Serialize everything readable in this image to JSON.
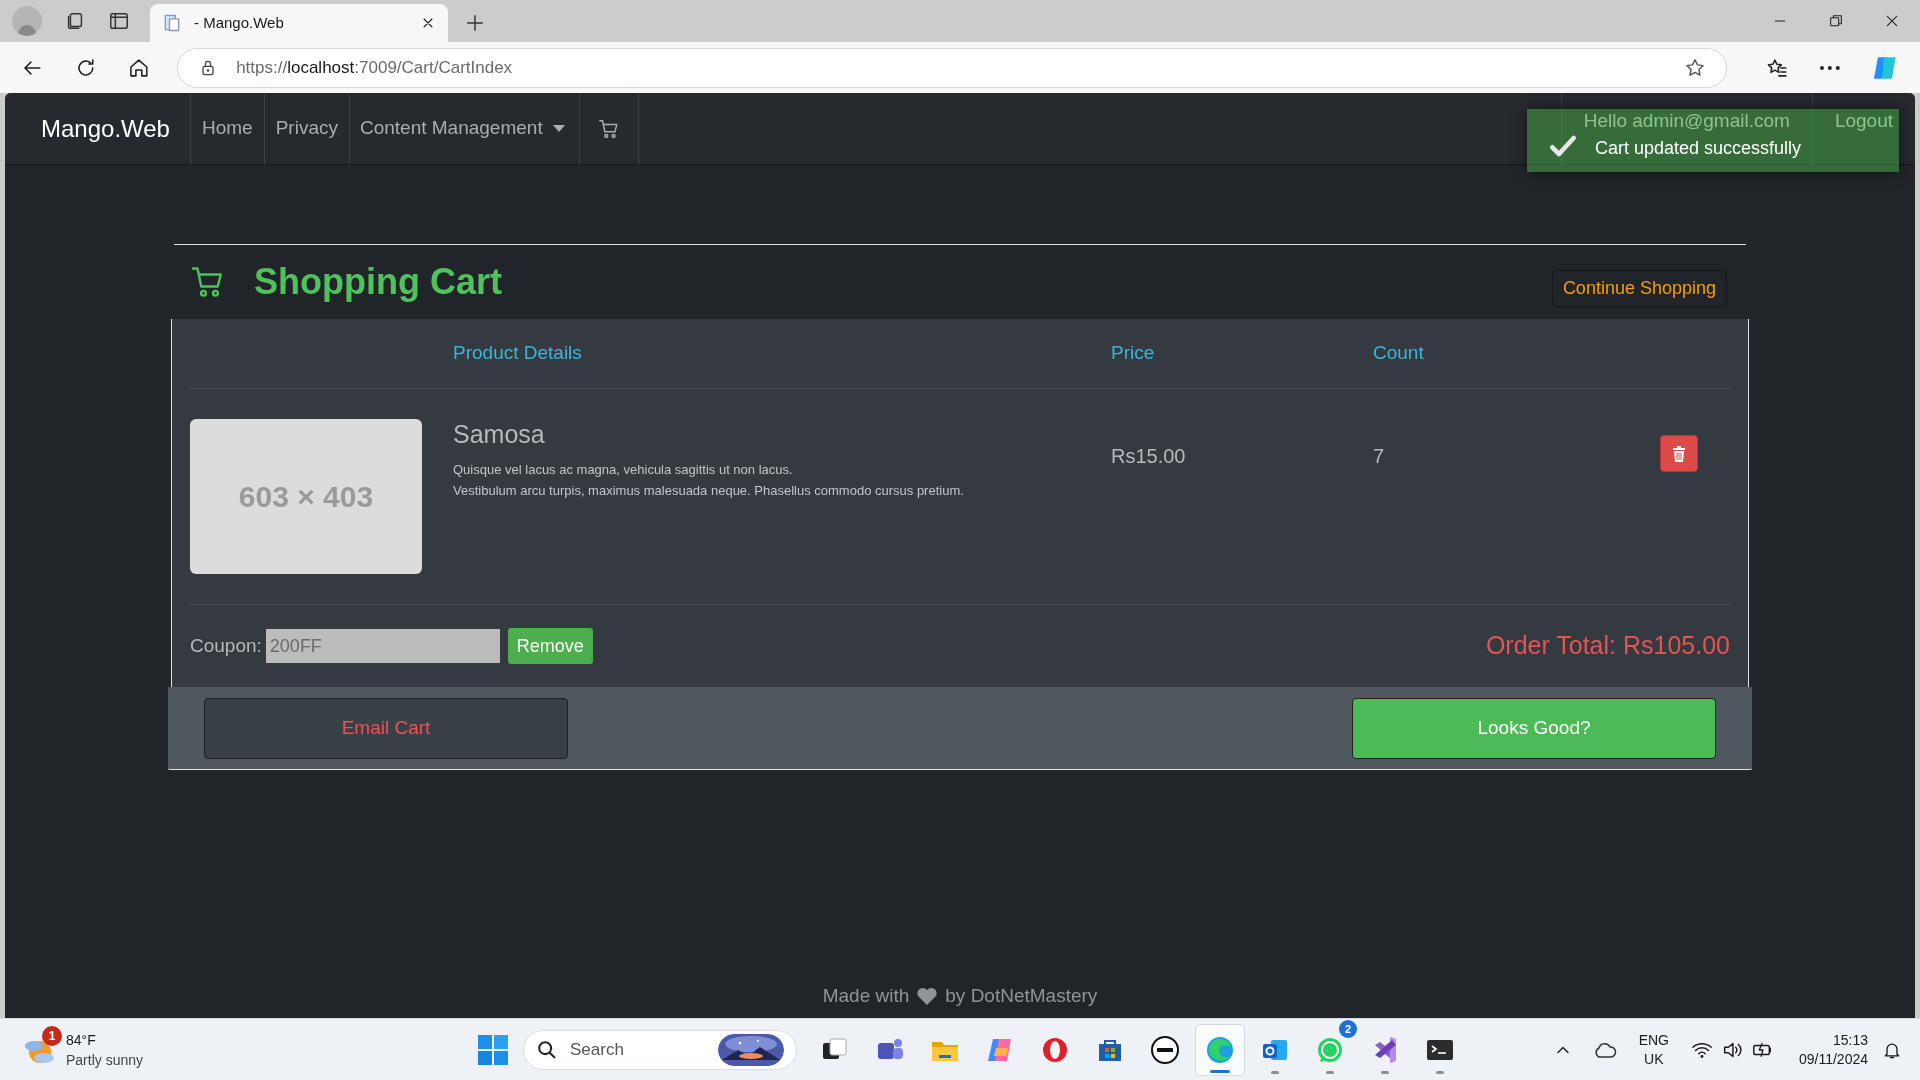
{
  "browser": {
    "tab_title": "- Mango.Web",
    "url_parts": [
      {
        "text": "https://",
        "emphasis": false
      },
      {
        "text": "localhost",
        "emphasis": true
      },
      {
        "text": ":7009/Cart/CartIndex",
        "emphasis": false
      }
    ]
  },
  "navbar": {
    "brand": "Mango.Web",
    "items": [
      {
        "kind": "link",
        "label": "Home"
      },
      {
        "kind": "link",
        "label": "Privacy"
      },
      {
        "kind": "dropdown",
        "label": "Content Management"
      },
      {
        "kind": "cart"
      }
    ],
    "user_items": [
      "Hello admin@gmail.com",
      "Logout"
    ]
  },
  "toast": {
    "message": "Cart updated successfully"
  },
  "cart": {
    "title": "Shopping Cart",
    "continue_button": "Continue Shopping",
    "columns": [
      "Product Details",
      "Price",
      "Count"
    ],
    "items": [
      {
        "image_label": "603 × 403",
        "name": "Samosa",
        "description": [
          "Quisque vel lacus ac magna, vehicula sagittis ut non lacus.",
          "Vestibulum arcu turpis, maximus malesuada neque. Phasellus commodo cursus pretium."
        ],
        "price": "Rs15.00",
        "count": "7"
      }
    ],
    "coupon": {
      "label": "Coupon:",
      "value": "200FF",
      "button": "Remove"
    },
    "order_total": "Order Total: Rs105.00",
    "email_button": "Email Cart",
    "confirm_button": "Looks Good?"
  },
  "footer": {
    "before": "Made with",
    "after": "by DotNetMastery"
  },
  "taskbar": {
    "weather": {
      "badge": "1",
      "temperature": "84°F",
      "condition": "Partly sunny"
    },
    "search_placeholder": "Search",
    "apps": [
      {
        "kind": "taskview",
        "running": false,
        "active": false
      },
      {
        "kind": "teams",
        "running": false,
        "active": false
      },
      {
        "kind": "files",
        "running": false,
        "active": false
      },
      {
        "kind": "copilot",
        "running": false,
        "active": false
      },
      {
        "kind": "opera",
        "running": false,
        "active": false
      },
      {
        "kind": "store",
        "running": false,
        "active": false
      },
      {
        "kind": "dell",
        "running": false,
        "active": false
      },
      {
        "kind": "edge",
        "running": true,
        "active": true
      },
      {
        "kind": "outlook",
        "running": true,
        "active": false
      },
      {
        "kind": "whatsapp",
        "running": true,
        "active": false,
        "badge": "2"
      },
      {
        "kind": "studio",
        "running": true,
        "active": false
      },
      {
        "kind": "terminal",
        "running": true,
        "active": false
      }
    ],
    "language": [
      "ENG",
      "UK"
    ],
    "time": "15:13",
    "date": "09/11/2024"
  }
}
